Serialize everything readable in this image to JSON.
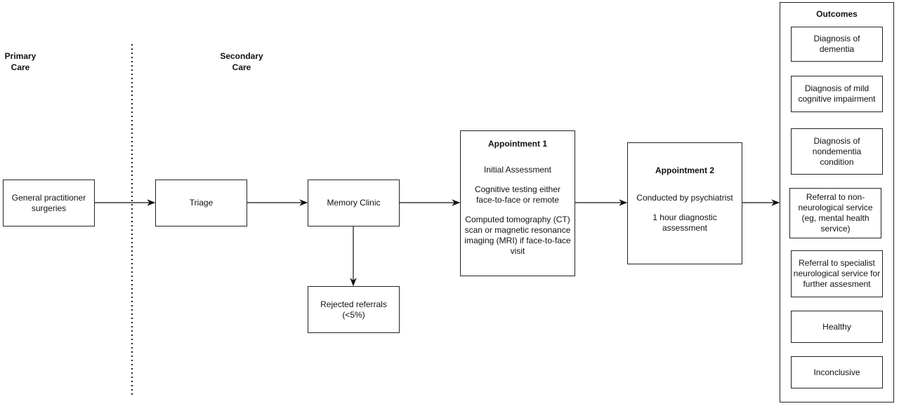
{
  "sections": {
    "primary": "Primary Care",
    "secondary": "Secondary Care"
  },
  "nodes": {
    "gp": "General practitioner surgeries",
    "triage": "Triage",
    "memory_clinic": "Memory Clinic",
    "rejected": "Rejected referrals (<5%)",
    "appointment1": {
      "title": "Appointment 1",
      "lines": [
        "Initial Assessment",
        "Cognitive testing either face-to-face or remote",
        "Computed tomography (CT) scan or magnetic resonance imaging (MRI) if face-to-face visit"
      ]
    },
    "appointment2": {
      "title": "Appointment 2",
      "lines": [
        "Conducted by psychiatrist",
        "1 hour diagnostic assessment"
      ]
    }
  },
  "outcomes": {
    "title": "Outcomes",
    "items": [
      "Diagnosis of dementia",
      "Diagnosis of mild cognitive impairment",
      "Diagnosis of nondementia condition",
      "Referral to non-neurological service (eg, mental health service)",
      "Referral to specialist neurological service for further assesment",
      "Healthy",
      "Inconclusive"
    ]
  }
}
